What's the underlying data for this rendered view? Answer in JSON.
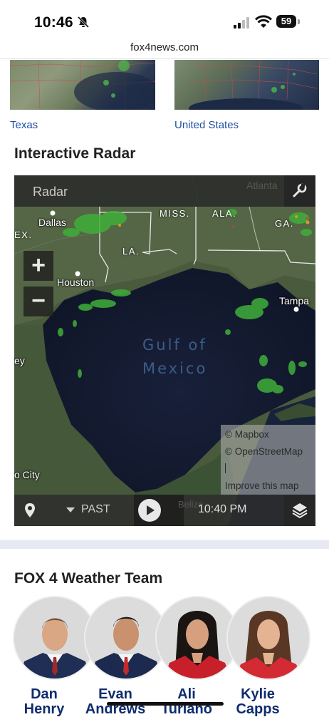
{
  "status_bar": {
    "time": "10:46",
    "battery": "59"
  },
  "browser": {
    "url": "fox4news.com"
  },
  "thumbnails": [
    {
      "label": "Texas"
    },
    {
      "label": "United States"
    }
  ],
  "radar_section": {
    "heading": "Interactive Radar",
    "widget_title": "Radar",
    "zoom_in": "+",
    "zoom_out": "−",
    "map_labels": {
      "dallas": "Dallas",
      "houston": "Houston",
      "tampa": "Tampa",
      "city": "o City",
      "ex": "EX.",
      "ey": "ey",
      "la": "LA.",
      "miss": "MISS.",
      "ala": "ALA.",
      "ga": "GA.",
      "atlanta": "Atlanta",
      "gulf_line1": "Gulf of",
      "gulf_line2": "Mexico",
      "belize": "Belize"
    },
    "attribution": {
      "mapbox": "© Mapbox",
      "osm": "© OpenStreetMap",
      "improve": "Improve this map"
    },
    "controls": {
      "past_label": "PAST",
      "time": "10:40 PM"
    }
  },
  "team_section": {
    "heading": "FOX 4 Weather Team",
    "members": [
      {
        "first": "Dan",
        "last": "Henry"
      },
      {
        "first": "Evan",
        "last": "Andrews"
      },
      {
        "first": "Ali",
        "last": "Turiano"
      },
      {
        "first": "Kylie",
        "last": "Capps"
      }
    ]
  },
  "colors": {
    "accent_link": "#1f4fa6",
    "name_navy": "#0f2c6e",
    "radar_green": "#3fae3a"
  }
}
